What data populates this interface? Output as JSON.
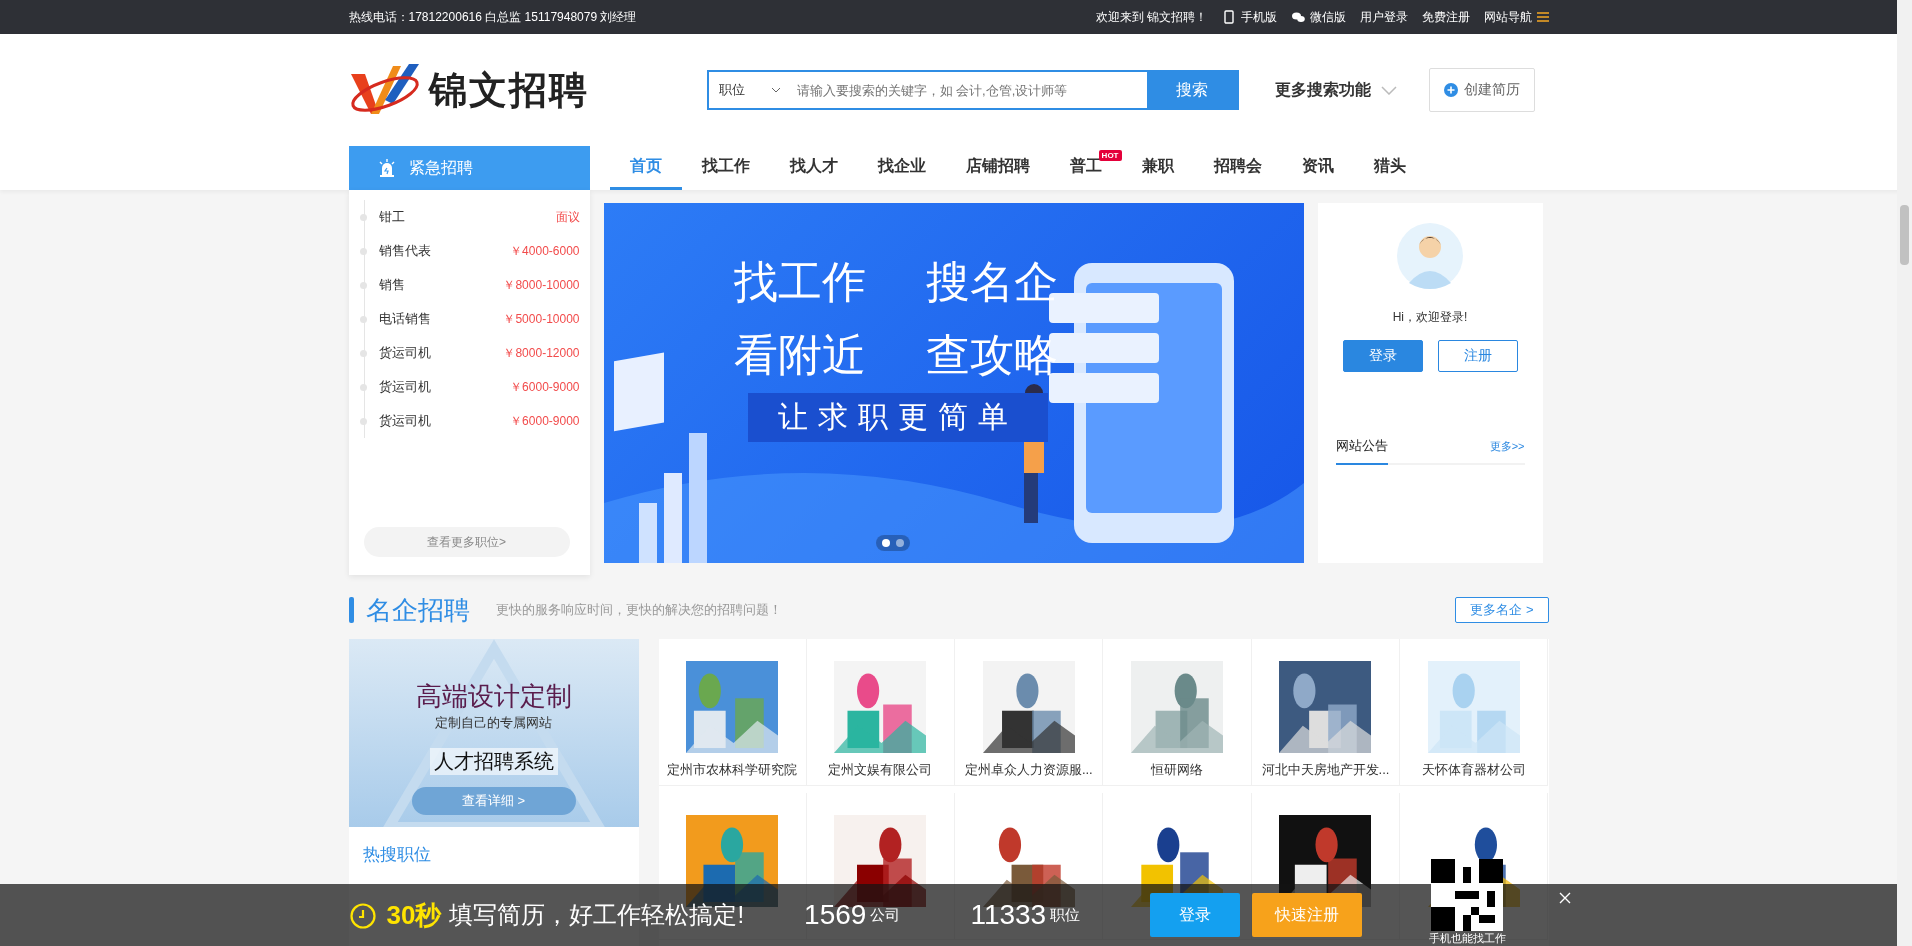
{
  "top_bar": {
    "hotline": "热线电话：17812200616 白总监 15117948079 刘经理",
    "welcome": "欢迎来到 锦文招聘！",
    "links": [
      "手机版",
      "微信版",
      "用户登录",
      "免费注册",
      "网站导航"
    ]
  },
  "header": {
    "logo_text": "锦文招聘",
    "search": {
      "category": "职位",
      "placeholder": "请输入要搜索的关键字，如 会计,仓管,设计师等",
      "button": "搜索"
    },
    "more_search": "更多搜索功能",
    "create_resume": "创建简历"
  },
  "nav": [
    {
      "label": "首页",
      "selected": true
    },
    {
      "label": "找工作",
      "selected": false
    },
    {
      "label": "找人才",
      "selected": false
    },
    {
      "label": "找企业",
      "selected": false
    },
    {
      "label": "店铺招聘",
      "selected": false
    },
    {
      "label": "普工",
      "selected": false,
      "badge": "HOT"
    },
    {
      "label": "兼职",
      "selected": false
    },
    {
      "label": "招聘会",
      "selected": false
    },
    {
      "label": "资讯",
      "selected": false
    },
    {
      "label": "猎头",
      "selected": false
    }
  ],
  "urgent": {
    "title": "紧急招聘",
    "jobs": [
      {
        "title": "钳工",
        "salary": "面议"
      },
      {
        "title": "销售代表",
        "salary": "￥4000-6000"
      },
      {
        "title": "销售",
        "salary": "￥8000-10000"
      },
      {
        "title": "电话销售",
        "salary": "￥5000-10000"
      },
      {
        "title": "货运司机",
        "salary": "￥8000-12000"
      },
      {
        "title": "货运司机",
        "salary": "￥6000-9000"
      },
      {
        "title": "货运司机",
        "salary": "￥6000-9000"
      }
    ],
    "more": "查看更多职位>"
  },
  "banner": {
    "lines": [
      "找工作",
      "搜名企",
      "看附近",
      "查攻略"
    ],
    "slogan": "让求职更简单",
    "dots": [
      {
        "selected": true
      },
      {
        "selected": false
      }
    ]
  },
  "login_panel": {
    "greeting": "Hi，欢迎登录!",
    "login": "登录",
    "register": "注册",
    "notice_title": "网站公告",
    "notice_more": "更多>>"
  },
  "famous": {
    "title": "名企招聘",
    "subtitle": "更快的服务响应时间，更快的解决您的招聘问题！",
    "more": "更多名企 >",
    "ad": {
      "headline": "高端设计定制",
      "sub": "定制自己的专属网站",
      "product": "人才招聘系统",
      "button": "查看详细 >"
    },
    "hot_title": "热搜职位",
    "companies": [
      {
        "kind": "picture",
        "name": "定州市农林科学研究院"
      },
      {
        "kind": "picture",
        "name": "定州文娱有限公司"
      },
      {
        "kind": "picture",
        "name": "定州卓众人力资源服..."
      },
      {
        "kind": "picture",
        "name": "恒研网络"
      },
      {
        "kind": "picture",
        "name": "河北中天房地产开发..."
      },
      {
        "kind": "picture",
        "name": "天怀体育器材公司"
      },
      {
        "kind": "picture"
      },
      {
        "kind": "picture"
      },
      {
        "kind": "picture"
      },
      {
        "kind": "picture"
      },
      {
        "kind": "picture"
      },
      {
        "kind": "picture"
      }
    ]
  },
  "promo_bar": {
    "seconds": "30秒",
    "text": "填写简历，好工作轻松搞定!",
    "company_count": "1569",
    "company_unit": "公司",
    "job_count": "11333",
    "job_unit": "职位",
    "login": "登录",
    "register": "快速注册",
    "qr_caption": "手机也能找工作"
  }
}
